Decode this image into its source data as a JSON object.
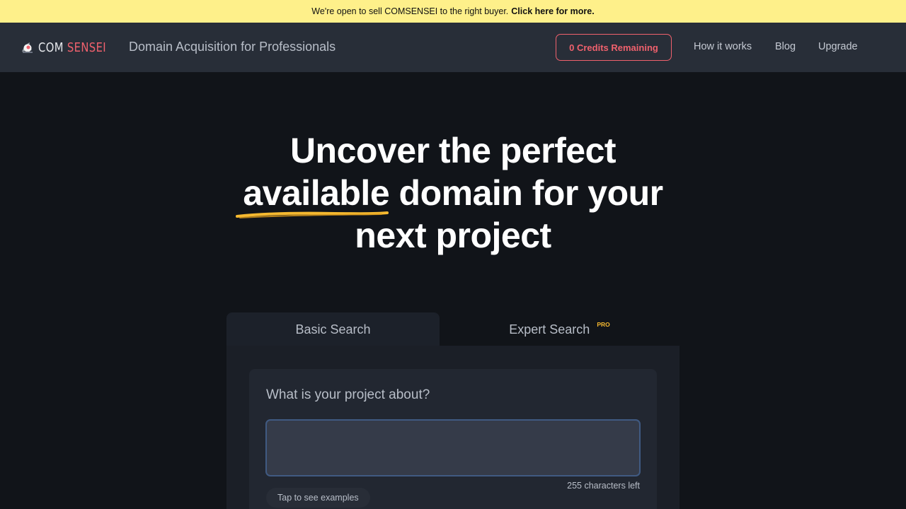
{
  "announcement": {
    "text": "We're open to sell COMSENSEI to the right buyer.",
    "link": "Click here for more."
  },
  "header": {
    "logo_part1": "COM",
    "logo_part2": "SENSEI",
    "tagline": "Domain Acquisition for Professionals",
    "credits_label": "0 Credits Remaining",
    "nav": [
      {
        "label": "How it works"
      },
      {
        "label": "Blog"
      },
      {
        "label": "Upgrade"
      }
    ]
  },
  "hero": {
    "line1": "Uncover the perfect",
    "line2_highlight": "available",
    "line2_rest": "domain for your",
    "line3": "next project"
  },
  "tabs": {
    "basic": "Basic Search",
    "expert": "Expert Search",
    "expert_badge": "PRO"
  },
  "search": {
    "question": "What is your project about?",
    "value": "",
    "chars_left": "255 characters left",
    "examples_label": "Tap to see examples"
  },
  "colors": {
    "accent": "#f0616d",
    "badge": "#f5b930",
    "announcement_bg": "#fef08a",
    "background": "#111419"
  }
}
